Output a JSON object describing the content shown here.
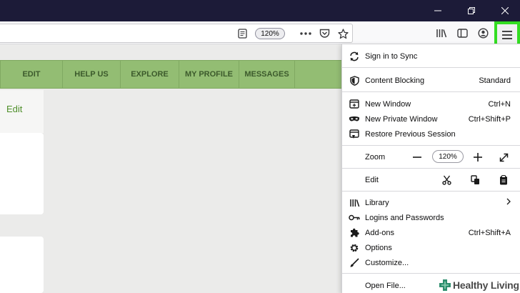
{
  "toolbar": {
    "zoom_label": "120%"
  },
  "page": {
    "nav": [
      "EDIT",
      "HELP US",
      "EXPLORE",
      "MY PROFILE",
      "MESSAGES"
    ],
    "edit_link": "Edit"
  },
  "menu": {
    "sync": "Sign in to Sync",
    "content_blocking": "Content Blocking",
    "content_blocking_value": "Standard",
    "new_window": "New Window",
    "new_window_shortcut": "Ctrl+N",
    "new_private": "New Private Window",
    "new_private_shortcut": "Ctrl+Shift+P",
    "restore": "Restore Previous Session",
    "zoom": "Zoom",
    "zoom_value": "120%",
    "edit": "Edit",
    "library": "Library",
    "logins": "Logins and Passwords",
    "addons": "Add-ons",
    "addons_shortcut": "Ctrl+Shift+A",
    "options": "Options",
    "customize": "Customize...",
    "open_file": "Open File..."
  },
  "watermark": {
    "brand": "Healthy Living"
  },
  "colors": {
    "titlebar": "#1c1b38",
    "nav_green": "#93bd73",
    "highlight": "#33dd22",
    "link_green": "#4f8f2a"
  }
}
